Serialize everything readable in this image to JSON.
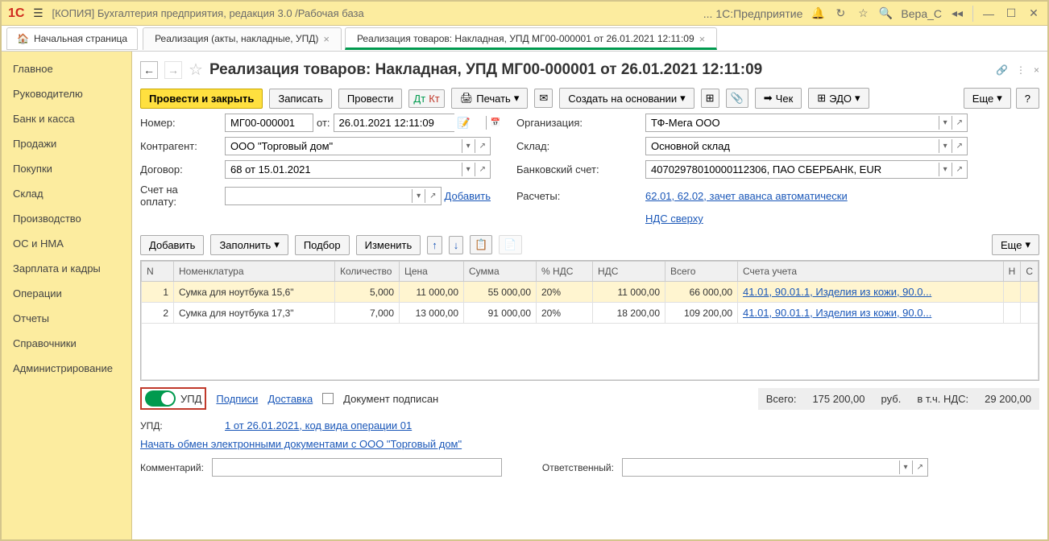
{
  "titlebar": {
    "logo": "1С",
    "title": "[КОПИЯ] Бухгалтерия предприятия, редакция 3.0 /Рабочая база",
    "app_name": "... 1С:Предприятие",
    "user": "Вера_С"
  },
  "tabs": {
    "home": "Начальная страница",
    "tab1": "Реализация (акты, накладные, УПД)",
    "tab2": "Реализация товаров: Накладная, УПД МГ00-000001 от 26.01.2021 12:11:09"
  },
  "sidebar": {
    "items": [
      "Главное",
      "Руководителю",
      "Банк и касса",
      "Продажи",
      "Покупки",
      "Склад",
      "Производство",
      "ОС и НМА",
      "Зарплата и кадры",
      "Операции",
      "Отчеты",
      "Справочники",
      "Администрирование"
    ]
  },
  "page": {
    "title": "Реализация товаров: Накладная, УПД МГ00-000001 от 26.01.2021 12:11:09"
  },
  "toolbar": {
    "post_close": "Провести и закрыть",
    "save": "Записать",
    "post": "Провести",
    "print": "Печать",
    "create_basis": "Создать на основании",
    "cheque": "Чек",
    "edo": "ЭДО",
    "more": "Еще"
  },
  "form": {
    "number_lbl": "Номер:",
    "number": "МГ00-000001",
    "ot": "от:",
    "date": "26.01.2021 12:11:09",
    "org_lbl": "Организация:",
    "org": "ТФ-Мега ООО",
    "contragent_lbl": "Контрагент:",
    "contragent": "ООО \"Торговый дом\"",
    "sklad_lbl": "Склад:",
    "sklad": "Основной склад",
    "dogovor_lbl": "Договор:",
    "dogovor": "68 от 15.01.2021",
    "bank_lbl": "Банковский счет:",
    "bank": "40702978010000112306, ПАО СБЕРБАНК, EUR",
    "invoice_lbl": "Счет на оплату:",
    "add_link": "Добавить",
    "raschety_lbl": "Расчеты:",
    "raschety_link": "62.01, 62.02, зачет аванса автоматически",
    "nds_link": "НДС сверху"
  },
  "table_toolbar": {
    "add": "Добавить",
    "fill": "Заполнить",
    "select": "Подбор",
    "change": "Изменить",
    "more": "Еще"
  },
  "table": {
    "headers": {
      "n": "N",
      "nom": "Номенклатура",
      "qty": "Количество",
      "price": "Цена",
      "sum": "Сумма",
      "vatp": "% НДС",
      "vat": "НДС",
      "total": "Всего",
      "accounts": "Счета учета",
      "h": "Н",
      "o": "С"
    },
    "rows": [
      {
        "n": "1",
        "nom": "Сумка для ноутбука 15,6\"",
        "qty": "5,000",
        "price": "11 000,00",
        "sum": "55 000,00",
        "vatp": "20%",
        "vat": "11 000,00",
        "total": "66 000,00",
        "acc": "41.01, 90.01.1, Изделия из кожи, 90.0..."
      },
      {
        "n": "2",
        "nom": "Сумка для ноутбука 17,3\"",
        "qty": "7,000",
        "price": "13 000,00",
        "sum": "91 000,00",
        "vatp": "20%",
        "vat": "18 200,00",
        "total": "109 200,00",
        "acc": "41.01, 90.01.1, Изделия из кожи, 90.0..."
      }
    ]
  },
  "footer": {
    "upd": "УПД",
    "sign": "Подписи",
    "delivery": "Доставка",
    "doc_signed": "Документ подписан",
    "total_lbl": "Всего:",
    "total": "175 200,00",
    "rub": "руб.",
    "vat_lbl": "в т.ч. НДС:",
    "vat": "29 200,00",
    "upd_lbl": "УПД:",
    "upd_link": "1 от 26.01.2021, код вида операции 01",
    "edo_link": "Начать обмен электронными документами с ООО \"Торговый дом\"",
    "comment_lbl": "Комментарий:",
    "resp_lbl": "Ответственный:"
  }
}
